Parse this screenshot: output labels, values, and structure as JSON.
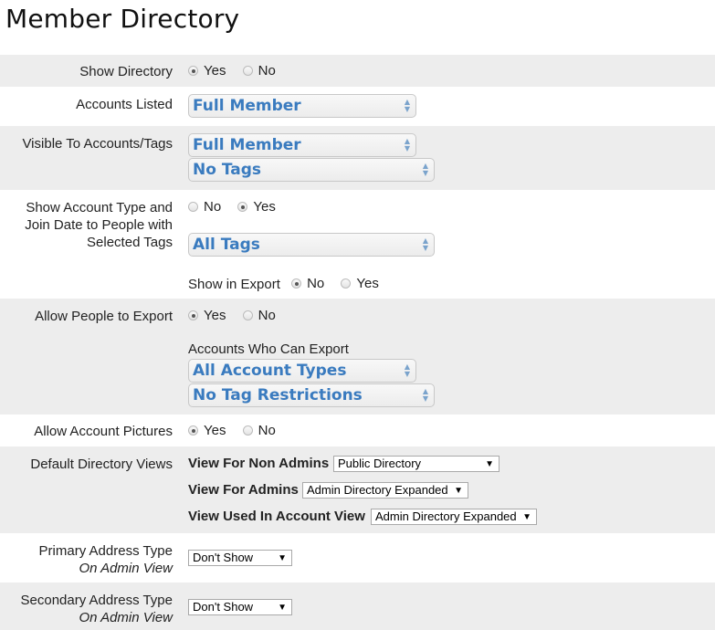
{
  "page_title": "Member Directory",
  "show_directory": {
    "label": "Show Directory",
    "options": [
      "Yes",
      "No"
    ],
    "selected": "Yes"
  },
  "accounts_listed": {
    "label": "Accounts Listed",
    "value": "Full Member"
  },
  "visible_to": {
    "label": "Visible To Accounts/Tags",
    "account_value": "Full Member",
    "tag_value": "No Tags"
  },
  "show_account_type": {
    "label_lines": [
      "Show Account Type and",
      "Join Date to People with",
      "Selected Tags"
    ],
    "options": [
      "No",
      "Yes"
    ],
    "selected": "Yes",
    "tag_value": "All Tags",
    "export_label": "Show in Export",
    "export_options": [
      "No",
      "Yes"
    ],
    "export_selected": "No"
  },
  "allow_export": {
    "label": "Allow People to Export",
    "options": [
      "Yes",
      "No"
    ],
    "selected": "Yes",
    "who_label": "Accounts Who Can Export",
    "account_value": "All Account Types",
    "tag_value": "No Tag Restrictions"
  },
  "allow_pictures": {
    "label": "Allow Account Pictures",
    "options": [
      "Yes",
      "No"
    ],
    "selected": "Yes"
  },
  "default_views": {
    "label": "Default Directory Views",
    "non_admins_label": "View For Non Admins",
    "non_admins_value": "Public Directory",
    "admins_label": "View For Admins",
    "admins_value": "Admin Directory Expanded",
    "account_view_label": "View Used In Account View",
    "account_view_value": "Admin Directory Expanded"
  },
  "primary_address": {
    "label": "Primary Address Type",
    "sublabel": "On Admin View",
    "value": "Don't Show"
  },
  "secondary_address": {
    "label": "Secondary Address Type",
    "sublabel": "On Admin View",
    "value": "Don't Show"
  },
  "icons": {
    "fancy_arrow": "⬍",
    "dropdown_arrow": "▼"
  }
}
